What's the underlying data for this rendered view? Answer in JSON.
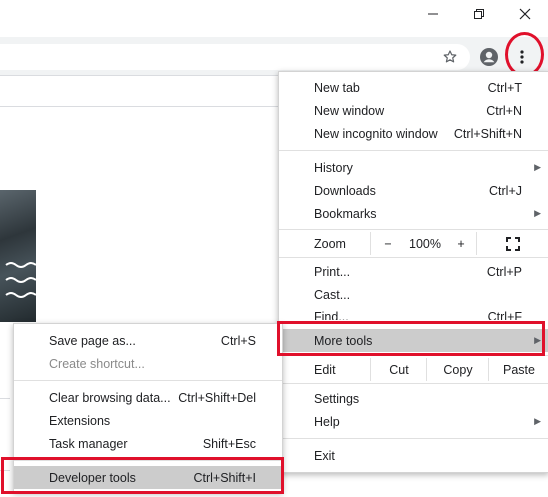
{
  "window": {
    "minimize_icon": "minimize-icon",
    "restore_icon": "restore-icon",
    "close_icon": "close-icon"
  },
  "toolbar": {
    "star_icon": "bookmark-star-icon",
    "profile_icon": "profile-avatar-icon",
    "menu_icon": "three-dot-menu-icon"
  },
  "main_menu": {
    "new_tab": {
      "label": "New tab",
      "shortcut": "Ctrl+T"
    },
    "new_window": {
      "label": "New window",
      "shortcut": "Ctrl+N"
    },
    "new_incognito": {
      "label": "New incognito window",
      "shortcut": "Ctrl+Shift+N"
    },
    "history": {
      "label": "History"
    },
    "downloads": {
      "label": "Downloads",
      "shortcut": "Ctrl+J"
    },
    "bookmarks": {
      "label": "Bookmarks"
    },
    "zoom": {
      "label": "Zoom",
      "minus": "−",
      "level": "100%",
      "plus": "+"
    },
    "print": {
      "label": "Print...",
      "shortcut": "Ctrl+P"
    },
    "cast": {
      "label": "Cast..."
    },
    "find": {
      "label": "Find...",
      "shortcut": "Ctrl+F"
    },
    "more_tools": {
      "label": "More tools"
    },
    "edit": {
      "label": "Edit",
      "cut": "Cut",
      "copy": "Copy",
      "paste": "Paste"
    },
    "settings": {
      "label": "Settings"
    },
    "help": {
      "label": "Help"
    },
    "exit": {
      "label": "Exit"
    }
  },
  "more_tools_menu": {
    "save_page": {
      "label": "Save page as...",
      "shortcut": "Ctrl+S"
    },
    "create_shortcut": {
      "label": "Create shortcut..."
    },
    "clear_browsing": {
      "label": "Clear browsing data...",
      "shortcut": "Ctrl+Shift+Del"
    },
    "extensions": {
      "label": "Extensions"
    },
    "task_manager": {
      "label": "Task manager",
      "shortcut": "Shift+Esc"
    },
    "developer_tools": {
      "label": "Developer tools",
      "shortcut": "Ctrl+Shift+I"
    }
  },
  "colors": {
    "highlight": "#cccccc",
    "annotation_red": "#e0102b"
  }
}
